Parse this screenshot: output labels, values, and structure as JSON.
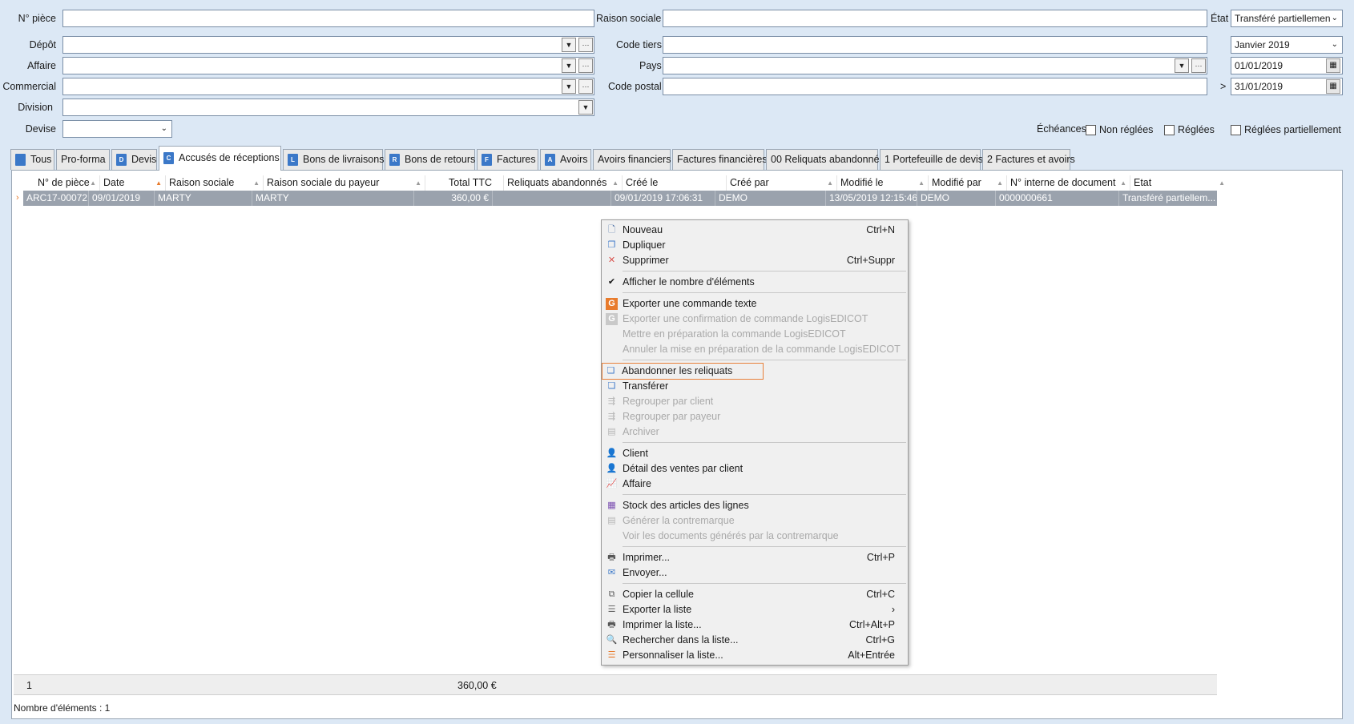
{
  "form": {
    "piece_label": "N° pièce",
    "depot_label": "Dépôt",
    "affaire_label": "Affaire",
    "commercial_label": "Commercial",
    "division_label": "Division",
    "devise_label": "Devise",
    "raison_sociale_label": "Raison sociale",
    "code_tiers_label": "Code tiers",
    "pays_label": "Pays",
    "code_postal_label": "Code postal",
    "etat_label": "État",
    "etat_value": "Transféré partiellemen",
    "periode_value": "Janvier 2019",
    "date_from": "01/01/2019",
    "date_to_prefix": ">",
    "date_to": "31/01/2019",
    "echeances_label": "Échéances",
    "non_reglees_label": "Non réglées",
    "reglees_label": "Réglées",
    "reglees_partiellement_label": "Réglées partiellement"
  },
  "tabs": [
    {
      "label": "Tous",
      "icon": "T"
    },
    {
      "label": "Pro-forma",
      "icon": ""
    },
    {
      "label": "Devis",
      "icon": "D"
    },
    {
      "label": "Accusés de réceptions",
      "icon": "C"
    },
    {
      "label": "Bons de livraisons",
      "icon": "L"
    },
    {
      "label": "Bons de retours",
      "icon": "R"
    },
    {
      "label": "Factures",
      "icon": "F"
    },
    {
      "label": "Avoirs",
      "icon": "A"
    },
    {
      "label": "Avoirs financiers",
      "icon": ""
    },
    {
      "label": "Factures financières",
      "icon": ""
    },
    {
      "label": "00 Reliquats abandonnés",
      "icon": ""
    },
    {
      "label": "1 Portefeuille de devis",
      "icon": ""
    },
    {
      "label": "2 Factures et avoirs",
      "icon": ""
    }
  ],
  "grid": {
    "columns": [
      "N° de pièce",
      "Date",
      "Raison sociale",
      "Raison sociale du payeur",
      "Total TTC",
      "Reliquats abandonnés",
      "Créé le",
      "Créé par",
      "Modifié le",
      "Modifié par",
      "N° interne de document",
      "Etat"
    ],
    "row": [
      "ARC17-00072",
      "09/01/2019",
      "MARTY",
      "MARTY",
      "360,00 €",
      "",
      "09/01/2019 17:06:31",
      "DEMO",
      "13/05/2019 12:15:46",
      "DEMO",
      "0000000661",
      "Transféré partiellem..."
    ],
    "row_marker": "›",
    "footer_count": "1",
    "footer_total": "360,00 €",
    "items_count_text": "Nombre d'éléments : 1"
  },
  "menu": {
    "nouveau": {
      "label": "Nouveau",
      "shortcut": "Ctrl+N"
    },
    "dupliquer": {
      "label": "Dupliquer"
    },
    "supprimer": {
      "label": "Supprimer",
      "shortcut": "Ctrl+Suppr"
    },
    "afficher_nombre": {
      "label": "Afficher le nombre d'éléments"
    },
    "exporter_commande": {
      "label": "Exporter une commande texte"
    },
    "exporter_confirmation": {
      "label": "Exporter une confirmation de commande LogisEDICOT"
    },
    "mettre_preparation": {
      "label": "Mettre en préparation la commande LogisEDICOT"
    },
    "annuler_preparation": {
      "label": "Annuler la mise en préparation de la commande LogisEDICOT"
    },
    "abandonner_reliquats": {
      "label": "Abandonner les reliquats"
    },
    "transferer": {
      "label": "Transférer"
    },
    "regrouper_client": {
      "label": "Regrouper par client"
    },
    "regrouper_payeur": {
      "label": "Regrouper par payeur"
    },
    "archiver": {
      "label": "Archiver"
    },
    "client": {
      "label": "Client"
    },
    "detail_ventes": {
      "label": "Détail des ventes par client"
    },
    "affaire": {
      "label": "Affaire"
    },
    "stock_articles": {
      "label": "Stock des articles des lignes"
    },
    "generer_contremarque": {
      "label": "Générer la contremarque"
    },
    "voir_documents": {
      "label": "Voir les documents générés par la contremarque"
    },
    "imprimer": {
      "label": "Imprimer...",
      "shortcut": "Ctrl+P"
    },
    "envoyer": {
      "label": "Envoyer..."
    },
    "copier_cellule": {
      "label": "Copier la cellule",
      "shortcut": "Ctrl+C"
    },
    "exporter_liste": {
      "label": "Exporter la liste",
      "shortcut": "›"
    },
    "imprimer_liste": {
      "label": "Imprimer la liste...",
      "shortcut": "Ctrl+Alt+P"
    },
    "rechercher_liste": {
      "label": "Rechercher dans la liste...",
      "shortcut": "Ctrl+G"
    },
    "personnaliser_liste": {
      "label": "Personnaliser la liste...",
      "shortcut": "Alt+Entrée"
    }
  },
  "colors": {
    "background": "#dce8f5",
    "selected_row": "#9aa2ad",
    "accent_orange": "#e87b2c",
    "tab_icon_blue": "#3b78c8"
  }
}
